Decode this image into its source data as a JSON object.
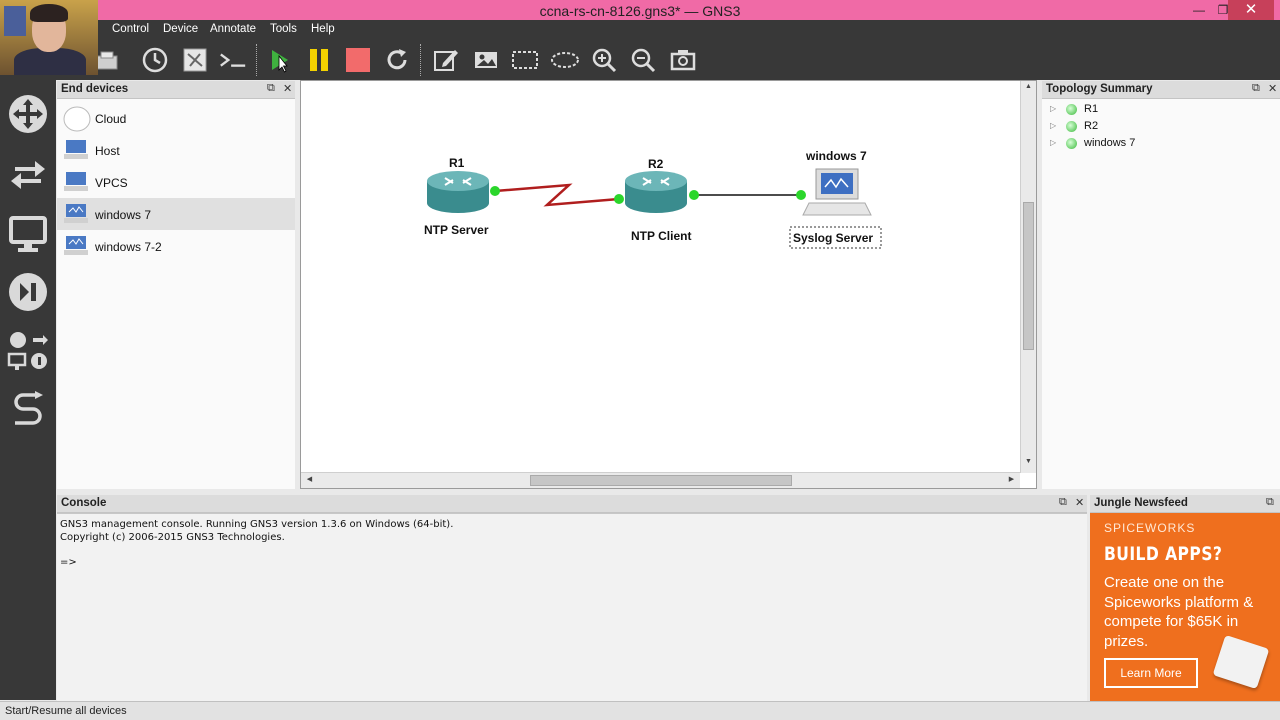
{
  "window": {
    "title": "ccna-rs-cn-8126.gns3* — GNS3",
    "minimize": "—",
    "restore": "❐",
    "close": "✕"
  },
  "menu": [
    "Control",
    "Device",
    "Annotate",
    "Tools",
    "Help"
  ],
  "end_devices": {
    "title": "End devices",
    "items": [
      {
        "label": "Cloud",
        "icon": "cloud-icon"
      },
      {
        "label": "Host",
        "icon": "host-icon"
      },
      {
        "label": "VPCS",
        "icon": "vpcs-icon"
      },
      {
        "label": "windows 7",
        "icon": "windows-icon",
        "selected": true
      },
      {
        "label": "windows 7-2",
        "icon": "windows-icon"
      }
    ]
  },
  "topology": {
    "nodes": [
      {
        "name": "R1",
        "label": "NTP Server",
        "type": "router"
      },
      {
        "name": "R2",
        "label": "NTP Client",
        "type": "router"
      },
      {
        "name": "windows 7",
        "label": "Syslog Server",
        "type": "host"
      }
    ],
    "link_colors": {
      "serial": "#b01e1e",
      "ethernet": "#111111",
      "port_up": "#2bd62b"
    }
  },
  "topology_summary": {
    "title": "Topology Summary",
    "items": [
      "R1",
      "R2",
      "windows 7"
    ]
  },
  "console": {
    "title": "Console",
    "lines": [
      "GNS3 management console. Running GNS3 version 1.3.6 on Windows (64-bit).",
      "Copyright (c) 2006-2015 GNS3 Technologies.",
      "",
      "=>"
    ]
  },
  "newsfeed": {
    "title": "Jungle Newsfeed",
    "brand": "SPICEWORKS",
    "headline": "BUILD APPS?",
    "body": "Create one on the Spiceworks platform & compete for $65K in prizes.",
    "button": "Learn More"
  },
  "status": "Start/Resume all devices",
  "colors": {
    "accent": "#f06aa6",
    "dark": "#383838",
    "news": "#ef6f1e"
  }
}
